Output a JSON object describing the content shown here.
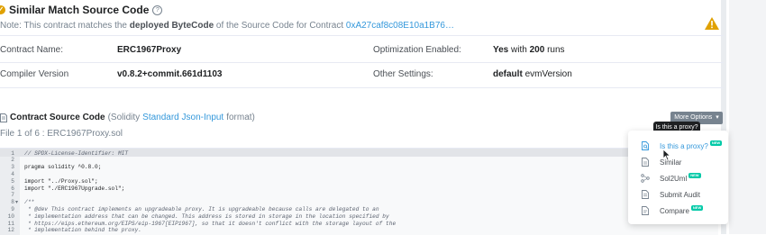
{
  "header": {
    "title": "Similar Match Source Code",
    "note_prefix": "Note: This contract matches the",
    "note_bold": "deployed ByteCode",
    "note_mid": "of the Source Code for Contract",
    "note_address": "0xA27caf8c08E10a1B76…"
  },
  "details": {
    "contract_name_label": "Contract Name:",
    "contract_name_value": "ERC1967Proxy",
    "compiler_label": "Compiler Version",
    "compiler_value": "v0.8.2+commit.661d1103",
    "optimization_label": "Optimization Enabled:",
    "optimization_value_bold": "Yes",
    "optimization_with": "with",
    "optimization_runs_bold": "200",
    "optimization_runs": "runs",
    "other_settings_label": "Other Settings:",
    "other_settings_bold": "default",
    "other_settings_value": "evmVersion"
  },
  "source": {
    "title": "Contract Source Code",
    "paren_open": "(Solidity",
    "format_link": "Standard Json-Input",
    "paren_close": "format)",
    "file_info": "File 1 of 6 : ERC1967Proxy.sol",
    "more_options": "More Options",
    "tooltip": "Is this a proxy?"
  },
  "code_lines": [
    {
      "n": "1",
      "t": "// SPDX-License-Identifier: MIT",
      "c": true,
      "f": ""
    },
    {
      "n": "2",
      "t": "",
      "c": false,
      "f": ""
    },
    {
      "n": "3",
      "t": "pragma solidity ^0.8.0;",
      "c": false,
      "f": ""
    },
    {
      "n": "4",
      "t": "",
      "c": false,
      "f": ""
    },
    {
      "n": "5",
      "t": "import \"../Proxy.sol\";",
      "c": false,
      "f": ""
    },
    {
      "n": "6",
      "t": "import \"./ERC1967Upgrade.sol\";",
      "c": false,
      "f": ""
    },
    {
      "n": "7",
      "t": "",
      "c": false,
      "f": ""
    },
    {
      "n": "8",
      "t": "/**",
      "c": true,
      "f": "▾"
    },
    {
      "n": "9",
      "t": " * @dev This contract implements an upgradeable proxy. It is upgradeable because calls are delegated to an",
      "c": true,
      "f": ""
    },
    {
      "n": "10",
      "t": " * implementation address that can be changed. This address is stored in storage in the location specified by",
      "c": true,
      "f": ""
    },
    {
      "n": "11",
      "t": " * https://eips.ethereum.org/EIPS/eip-1967[EIP1967], so that it doesn't conflict with the storage layout of the",
      "c": true,
      "f": ""
    },
    {
      "n": "12",
      "t": " * implementation behind the proxy.",
      "c": true,
      "f": ""
    }
  ],
  "menu": {
    "items": [
      {
        "label": "Is this a proxy?",
        "new": "NEW",
        "icon": "file-search-icon"
      },
      {
        "label": "Similar",
        "new": "",
        "icon": "document-icon"
      },
      {
        "label": "Sol2Uml",
        "new": "NEW",
        "icon": "diagram-icon"
      },
      {
        "label": "Submit Audit",
        "new": "",
        "icon": "audit-document-icon"
      },
      {
        "label": "Compare",
        "new": "NEW",
        "icon": "compare-document-icon"
      }
    ]
  },
  "colors": {
    "link": "#3498db",
    "warning": "#e0a100",
    "new_badge": "#00c9a7",
    "tooltip_bg": "#1e2022",
    "button_bg": "#77838f"
  }
}
